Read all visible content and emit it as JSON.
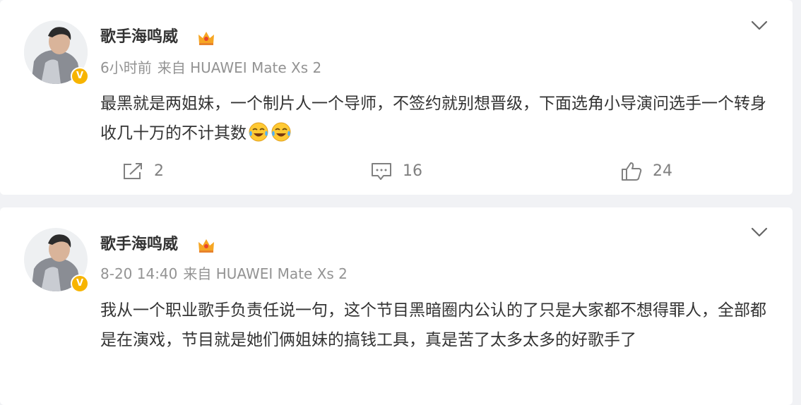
{
  "posts": [
    {
      "username": "歌手海鸣威",
      "time": "6小时前",
      "source": "来自 HUAWEI Mate Xs 2",
      "content": "最黑就是两姐妹，一个制片人一个导师，不签约就别想晋级，下面选角小导演问选手一个转身收几十万的不计其数",
      "emojis": [
        "laugh-cry-emoji",
        "laugh-cry-emoji"
      ],
      "actions": {
        "repost": "2",
        "comment": "16",
        "like": "24"
      },
      "verified_badge": "V"
    },
    {
      "username": "歌手海鸣威",
      "time": "8-20 14:40",
      "source": "来自 HUAWEI Mate Xs 2",
      "content": "我从一个职业歌手负责任说一句，这个节目黑暗圈内公认的了只是大家都不想得罪人，全部都是在演戏，节目就是她们俩姐妹的搞钱工具，真是苦了太多太多的好歌手了",
      "verified_badge": "V"
    }
  ],
  "colors": {
    "background": "#f1f2f5",
    "card": "#ffffff",
    "username": "#333333",
    "meta": "#939393",
    "badge": "#f7b400",
    "action": "#808080"
  },
  "icons": {
    "member": "crown-icon",
    "expand": "chevron-down-icon",
    "repost": "repost-icon",
    "comment": "comment-icon",
    "like": "like-icon"
  }
}
